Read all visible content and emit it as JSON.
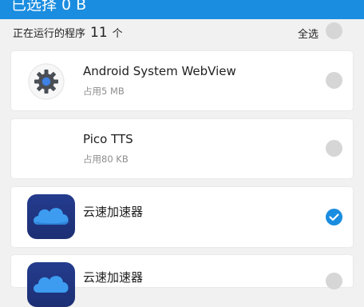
{
  "header": {
    "title": "已选择 0 B"
  },
  "summary": {
    "running_label": "正在运行的程序",
    "running_count": "11",
    "running_unit": "个",
    "select_all_label": "全选"
  },
  "apps": [
    {
      "name": "Android System WebView",
      "size": "占用5 MB",
      "icon": "gear-icon",
      "checked": false
    },
    {
      "name": "Pico TTS",
      "size": "占用80 KB",
      "icon": "none",
      "checked": false
    },
    {
      "name": "云速加速器",
      "size": "",
      "icon": "cloud-icon",
      "checked": true
    },
    {
      "name": "云速加速器",
      "size": "",
      "icon": "cloud-icon",
      "checked": false
    }
  ],
  "colors": {
    "accent": "#1a8de0",
    "background": "#f1f1f1",
    "unchecked": "#d6d6d6",
    "icon_bg": "#243c8e",
    "cloud": "#3d9cf0"
  }
}
